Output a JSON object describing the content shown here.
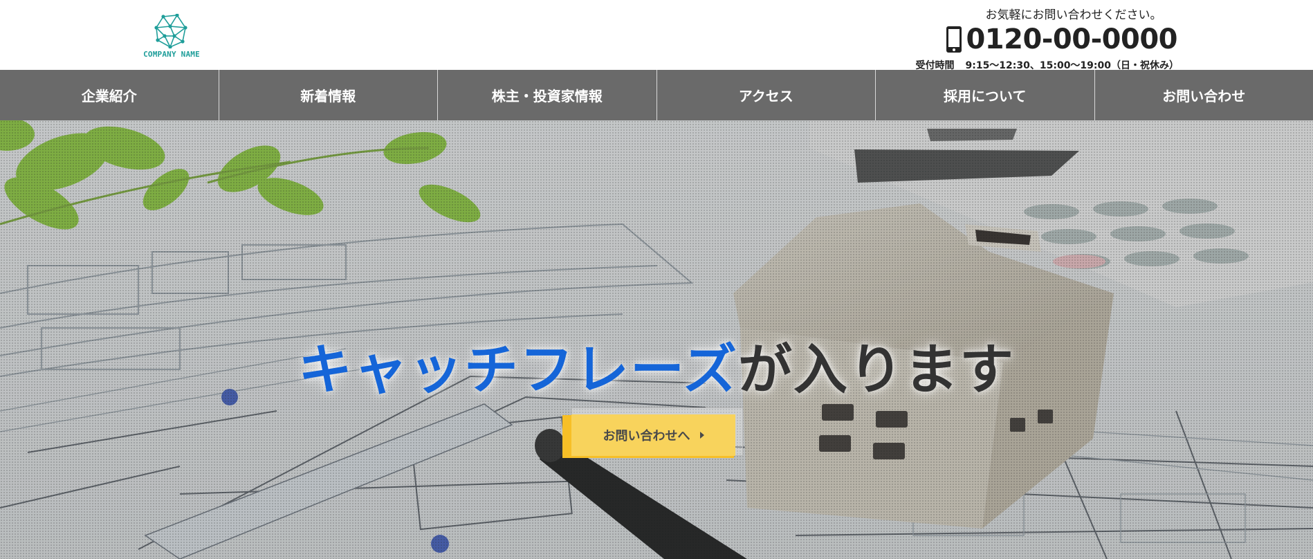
{
  "header": {
    "logo_text": "COMPANY NAME",
    "contact_lead": "お気軽にお問い合わせください。",
    "tel": "0120-00-0000",
    "hours_label": "受付時間",
    "hours_value": "9:15～12:30、15:00～19:00（日・祝休み）"
  },
  "nav": {
    "items": [
      {
        "label": "企業紹介"
      },
      {
        "label": "新着情報"
      },
      {
        "label": "株主・投資家情報"
      },
      {
        "label": "アクセス"
      },
      {
        "label": "採用について"
      },
      {
        "label": "お問い合わせ"
      }
    ]
  },
  "hero": {
    "catch_blue": "キャッチフレーズ",
    "catch_dark": "が入ります",
    "cta_label": "お問い合わせへ",
    "icons": {
      "cta_arrow": "caret-right-icon",
      "phone": "smartphone-icon",
      "logo": "network-polygon-logo"
    }
  },
  "colors": {
    "nav_bg": "#6a6a6a",
    "logo_teal": "#1f9e9a",
    "catch_blue": "#1565d8",
    "cta_yellow": "#f8d35c",
    "cta_shadow": "#f7bf27"
  }
}
